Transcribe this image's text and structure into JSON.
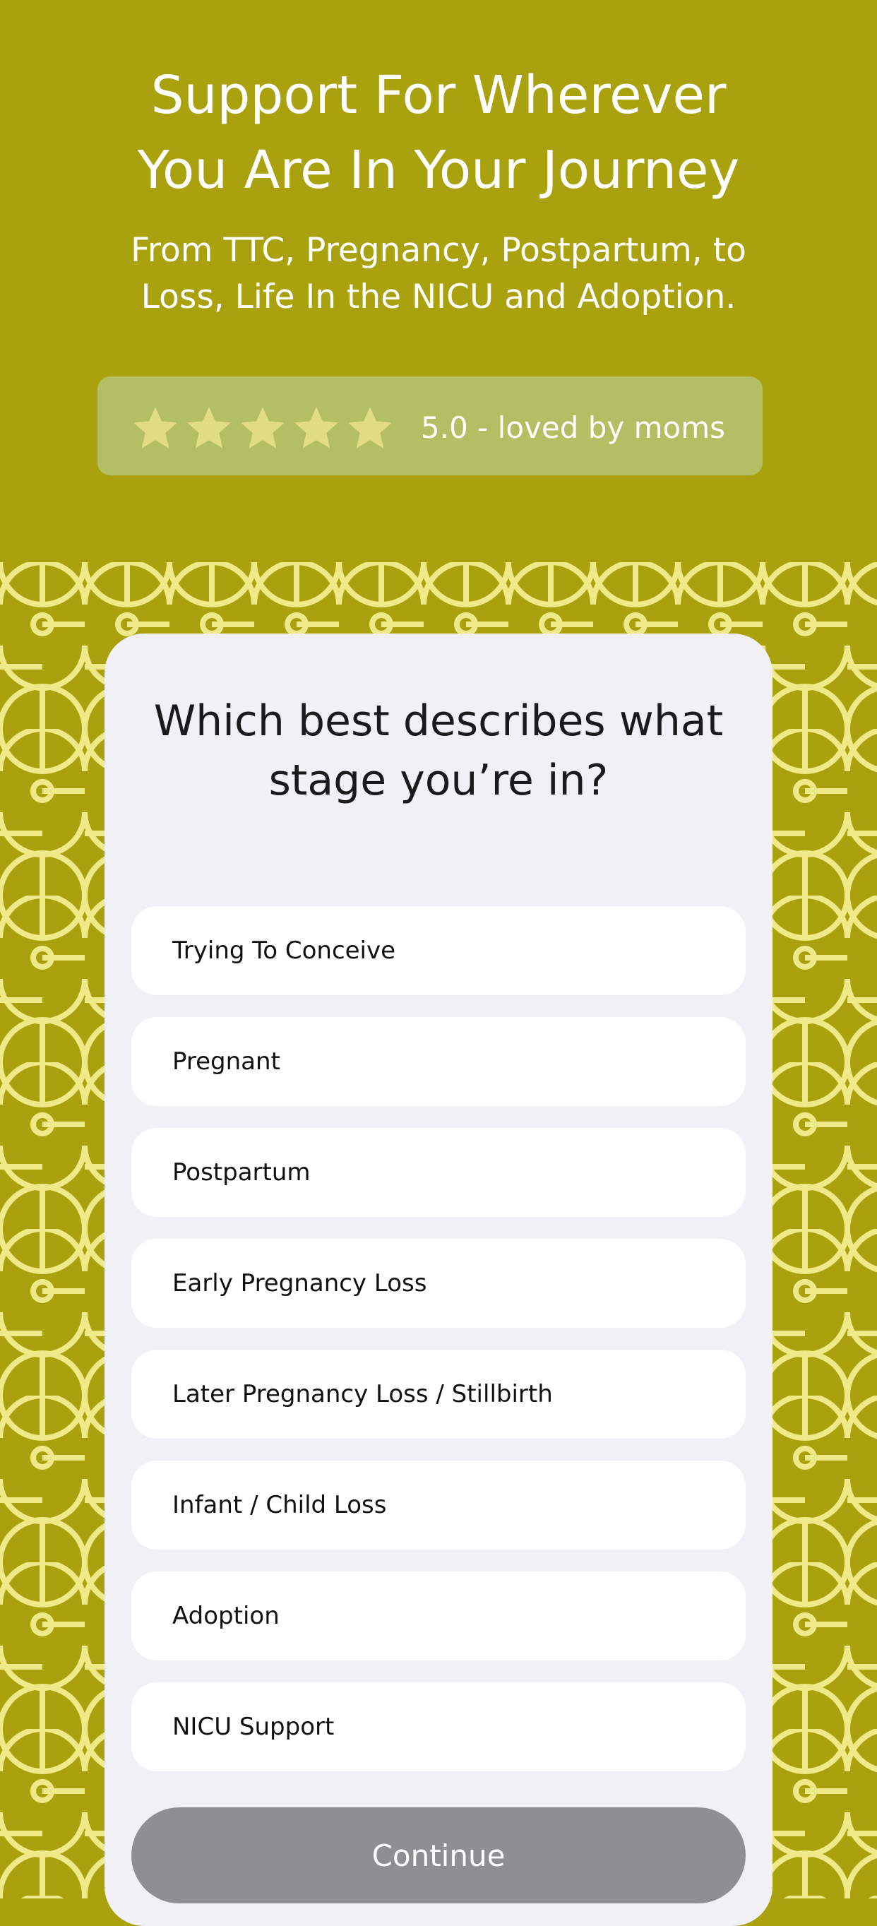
{
  "hero": {
    "title_line1": "Support For Wherever",
    "title_line2": "You Are In Your Journey",
    "subtitle_line1": "From TTC, Pregnancy, Postpartum, to",
    "subtitle_line2": "Loss, Life In the NICU and Adoption."
  },
  "rating": {
    "stars": 5,
    "text": "5.0 - loved by moms"
  },
  "quiz": {
    "question_line1": "Which best describes what",
    "question_line2": "stage you’re in?",
    "options": [
      "Trying To Conceive",
      "Pregnant",
      "Postpartum",
      "Early Pregnancy Loss",
      "Later Pregnancy Loss / Stillbirth",
      "Infant / Child Loss",
      "Adoption",
      "NICU Support"
    ],
    "continue_label": "Continue"
  },
  "colors": {
    "brand": "#a9a20e",
    "pattern_line": "#efe98a",
    "star": "#e2dc84",
    "card": "#f0f0f5",
    "button_disabled": "#8e8e93"
  }
}
